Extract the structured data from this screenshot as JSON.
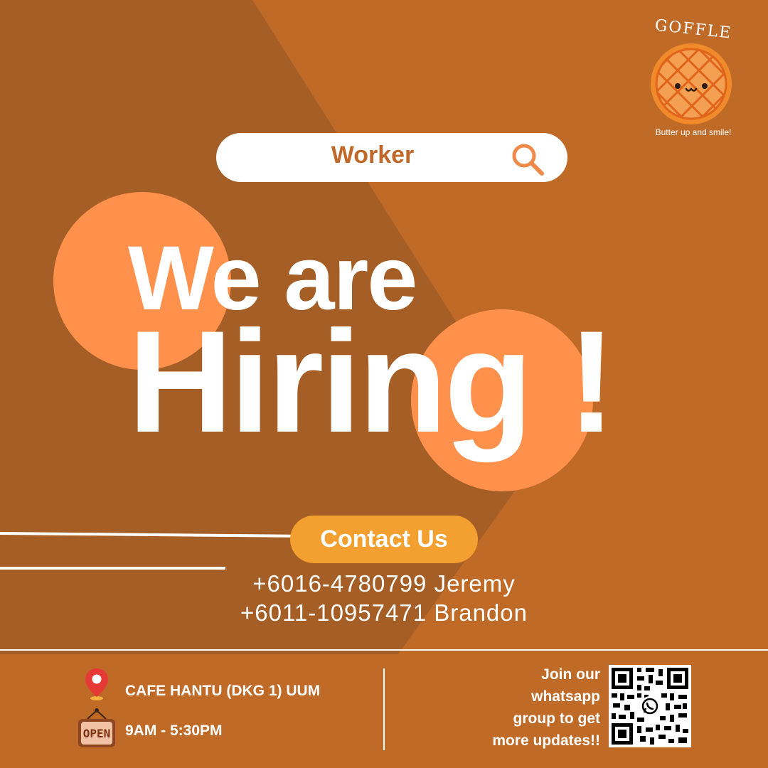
{
  "brand": {
    "name": "GOFFLE",
    "tagline": "Butter up and smile!"
  },
  "search": {
    "value": "Worker",
    "icon": "search-icon"
  },
  "headline": {
    "line1": "We are",
    "line2": "Hiring !"
  },
  "contact": {
    "button_label": "Contact Us",
    "phones": [
      "+6016-4780799 Jeremy",
      "+6011-10957471 Brandon"
    ]
  },
  "footer": {
    "location": "CAFE HANTU (DKG 1) UUM",
    "location_icon": "map-pin-icon",
    "open_sign": "OPEN",
    "hours": "9AM - 5:30PM",
    "join_lines": [
      "Join our",
      "whatsapp",
      "group to get",
      "more updates!!"
    ],
    "qr_icon": "whatsapp-icon"
  },
  "colors": {
    "background": "#c06a28",
    "dark_panel": "#a55e26",
    "accent_circle": "#ff914d",
    "button": "#f4a030",
    "text": "#ffffff"
  }
}
